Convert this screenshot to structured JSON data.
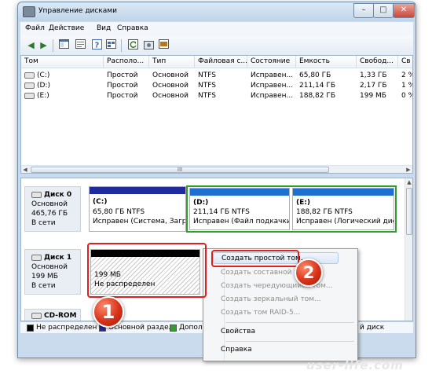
{
  "window": {
    "title": "Управление дисками",
    "controls": {
      "minimize": "–",
      "maximize": "□",
      "close": "✕"
    }
  },
  "menu": [
    "Файл",
    "Действие",
    "Вид",
    "Справка"
  ],
  "toolbar_icons": [
    "back-arrow-icon",
    "forward-arrow-icon",
    "console-tree-icon",
    "properties-icon",
    "help-icon",
    "refresh-icon",
    "settings-icon",
    "disk-icon"
  ],
  "volumes": {
    "columns": [
      "Том",
      "Располо...",
      "Тип",
      "Файловая с...",
      "Состояние",
      "Емкость",
      "Свобод...",
      "Св"
    ],
    "rows": [
      [
        "(C:)",
        "Простой",
        "Основной",
        "NTFS",
        "Исправен...",
        "65,80 ГБ",
        "1,33 ГБ",
        "2 %"
      ],
      [
        "(D:)",
        "Простой",
        "Основной",
        "NTFS",
        "Исправен...",
        "211,14 ГБ",
        "2,17 ГБ",
        "1 %"
      ],
      [
        "(E:)",
        "Простой",
        "Основной",
        "NTFS",
        "Исправен...",
        "188,82 ГБ",
        "199 МБ",
        "0 %"
      ]
    ]
  },
  "disks": [
    {
      "name": "Диск 0",
      "type": "Основной",
      "size": "465,76 ГБ",
      "state": "В сети",
      "partitions": [
        {
          "label": "(C:)",
          "fs": "65,80 ГБ NTFS",
          "status": "Исправен (Система, Загр"
        },
        {
          "label": "(D:)",
          "fs": "211,14 ГБ NTFS",
          "status": "Исправен (Файл подкачки,"
        },
        {
          "label": "(E:)",
          "fs": "188,82 ГБ NTFS",
          "status": "Исправен (Логический дис"
        }
      ]
    },
    {
      "name": "Диск 1",
      "type": "Основной",
      "size": "199 МБ",
      "state": "В сети",
      "partitions": [
        {
          "size": "199 МБ",
          "status": "Не распределен"
        }
      ]
    },
    {
      "name": "CD-ROM 0"
    }
  ],
  "legend": [
    "Не распределен",
    "Основной раздел",
    "Допол",
    "й диск"
  ],
  "legend_colors": {
    "unallocated": "#000000",
    "primary": "#1f2a9c",
    "extended": "#2f9e2f",
    "logical": "#1f6fd1"
  },
  "context_menu": {
    "items": [
      {
        "label": "Создать простой том...",
        "enabled": true
      },
      {
        "label": "Создать составной том...",
        "enabled": false
      },
      {
        "label": "Создать чередующийся том...",
        "enabled": false
      },
      {
        "label": "Создать зеркальный том...",
        "enabled": false
      },
      {
        "label": "Создать том RAID-5...",
        "enabled": false
      },
      {
        "label": "Свойства",
        "enabled": true
      },
      {
        "label": "Справка",
        "enabled": true
      }
    ]
  },
  "callouts": [
    "1",
    "2"
  ],
  "watermark": "user-life.com"
}
